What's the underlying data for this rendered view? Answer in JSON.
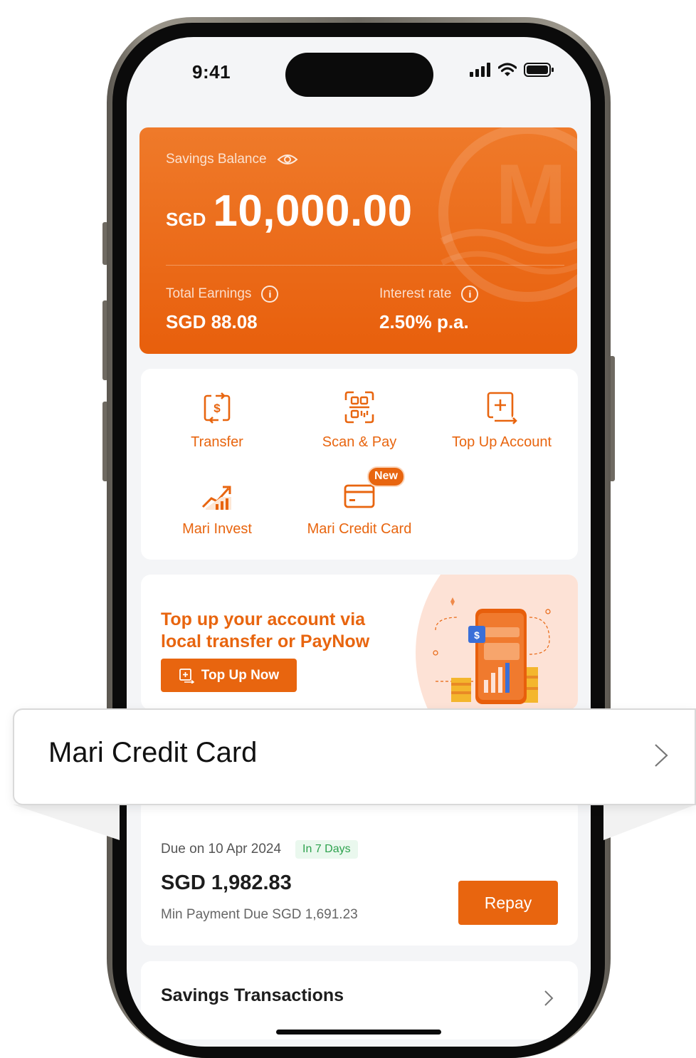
{
  "colors": {
    "accent": "#e8650f",
    "card_top": "#ef7a2a",
    "success": "#2ea24e"
  },
  "status_bar": {
    "time": "9:41"
  },
  "balance_card": {
    "label": "Savings Balance",
    "currency": "SGD",
    "amount": "10,000.00",
    "earnings_label": "Total Earnings",
    "earnings_value": "SGD 88.08",
    "rate_label": "Interest rate",
    "rate_value": "2.50% p.a.",
    "logo_letter": "M"
  },
  "actions": [
    {
      "label": "Transfer",
      "icon": "transfer-dollar-icon"
    },
    {
      "label": "Scan & Pay",
      "icon": "qr-scan-icon"
    },
    {
      "label": "Top Up Account",
      "icon": "top-up-icon"
    },
    {
      "label": "Mari Invest",
      "icon": "invest-chart-icon"
    },
    {
      "label": "Mari Credit Card",
      "icon": "credit-card-icon",
      "badge": "New"
    }
  ],
  "promo": {
    "title": "Top up your account via local transfer or PayNow",
    "button_label": "Top Up Now"
  },
  "overlay": {
    "title": "Mari Credit Card"
  },
  "credit": {
    "due_label": "Due on 10 Apr 2024",
    "days_badge": "In 7 Days",
    "amount": "SGD 1,982.83",
    "min_payment": "Min Payment Due SGD 1,691.23",
    "repay_label": "Repay"
  },
  "transactions": {
    "title": "Savings Transactions"
  }
}
